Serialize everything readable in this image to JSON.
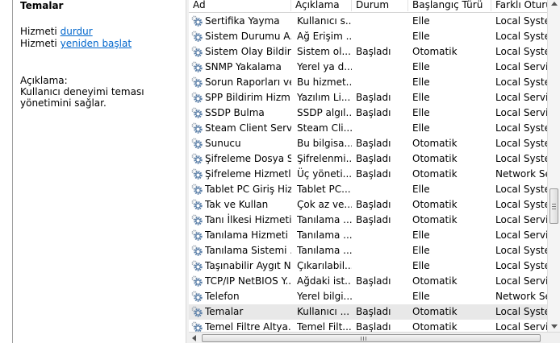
{
  "detail": {
    "title": "Temalar",
    "stop_prefix": "Hizmeti ",
    "stop_link": "durdur",
    "restart_prefix": "Hizmeti ",
    "restart_link": "yeniden başlat",
    "desc_label": "Açıklama:",
    "desc_text": "Kullanıcı deneyimi teması yönetimini sağlar."
  },
  "columns": [
    "Ad",
    "Açıklama",
    "Durum",
    "Başlangıç Türü",
    "Farklı Oturum"
  ],
  "rows": [
    {
      "name": "Sertifika Yayma",
      "desc": "Kullanıcı s...",
      "status": "",
      "startup": "Elle",
      "logon": "Local System"
    },
    {
      "name": "Sistem Durumu A...",
      "desc": "Ağ Erişim ...",
      "status": "",
      "startup": "Elle",
      "logon": "Local System"
    },
    {
      "name": "Sistem Olay Bildiri...",
      "desc": "Sistem ol...",
      "status": "Başladı",
      "startup": "Otomatik",
      "logon": "Local System"
    },
    {
      "name": "SNMP Yakalama",
      "desc": "Yerel ya d...",
      "status": "",
      "startup": "Elle",
      "logon": "Local Service"
    },
    {
      "name": "Sorun Raporları ve...",
      "desc": "Bu hizmet...",
      "status": "",
      "startup": "Elle",
      "logon": "Local System"
    },
    {
      "name": "SPP Bildirim Hizm...",
      "desc": "Yazılım Li...",
      "status": "Başladı",
      "startup": "Elle",
      "logon": "Local Service"
    },
    {
      "name": "SSDP Bulma",
      "desc": "SSDP algıl...",
      "status": "Başladı",
      "startup": "Elle",
      "logon": "Local Service"
    },
    {
      "name": "Steam Client Servi...",
      "desc": "Steam Cli...",
      "status": "",
      "startup": "Elle",
      "logon": "Local System"
    },
    {
      "name": "Sunucu",
      "desc": "Bu bilgisa...",
      "status": "Başladı",
      "startup": "Otomatik",
      "logon": "Local System"
    },
    {
      "name": "Şifreleme Dosya Si...",
      "desc": "Şifrelenmi...",
      "status": "Başladı",
      "startup": "Otomatik",
      "logon": "Local System"
    },
    {
      "name": "Şifreleme Hizmetleri",
      "desc": "Üç yöneti...",
      "status": "Başladı",
      "startup": "Otomatik",
      "logon": "Network Service"
    },
    {
      "name": "Tablet PC Giriş Hiz...",
      "desc": "Tablet PC...",
      "status": "",
      "startup": "Elle",
      "logon": "Local System"
    },
    {
      "name": "Tak ve Kullan",
      "desc": "Çok az ve...",
      "status": "Başladı",
      "startup": "Otomatik",
      "logon": "Local System"
    },
    {
      "name": "Tanı İlkesi Hizmeti",
      "desc": "Tanılama ...",
      "status": "Başladı",
      "startup": "Otomatik",
      "logon": "Local Service"
    },
    {
      "name": "Tanılama Hizmeti ...",
      "desc": "Tanılama ...",
      "status": "",
      "startup": "Elle",
      "logon": "Local Service"
    },
    {
      "name": "Tanılama Sistemi ...",
      "desc": "Tanılama ...",
      "status": "",
      "startup": "Elle",
      "logon": "Local System"
    },
    {
      "name": "Taşınabilir Aygıt N...",
      "desc": "Çıkarılabil...",
      "status": "",
      "startup": "Elle",
      "logon": "Local System"
    },
    {
      "name": "TCP/IP NetBIOS Y...",
      "desc": "Ağdaki ist...",
      "status": "Başladı",
      "startup": "Otomatik",
      "logon": "Local Service"
    },
    {
      "name": "Telefon",
      "desc": "Yerel bilgi...",
      "status": "",
      "startup": "Elle",
      "logon": "Network Service"
    },
    {
      "name": "Temalar",
      "desc": "Kullanıcı ...",
      "status": "Başladı",
      "startup": "Otomatik",
      "logon": "Local System"
    },
    {
      "name": "Temel Filtre Altya...",
      "desc": "Temel Filt...",
      "status": "Başladı",
      "startup": "Otomatik",
      "logon": "Local Service"
    }
  ],
  "selected_row": 19,
  "colors": {
    "link": "#0066cc",
    "selected_row": "#e8e8e8",
    "gear_blue": "#5b7fa8",
    "gear_gray": "#9aa6b2"
  }
}
